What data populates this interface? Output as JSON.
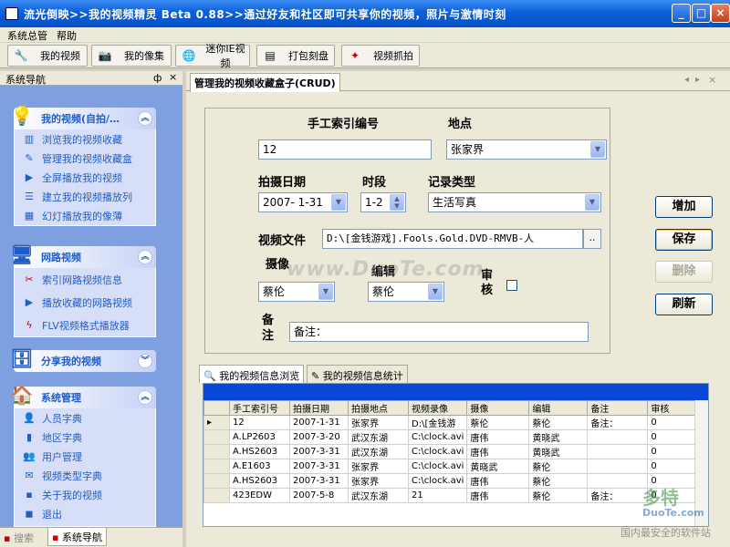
{
  "window": {
    "title": "流光倒映>>我的视频精灵 Beta 0.88>>通过好友和社区即可共享你的视频，照片与激情时刻"
  },
  "menu": [
    "系统总管",
    "帮助"
  ],
  "toolbar": [
    "我的视频",
    "我的像集",
    "迷你IE视频",
    "打包刻盘",
    "视频抓拍"
  ],
  "nav": {
    "title": "系统导航",
    "pin": "ф",
    "close": "×",
    "groups": [
      {
        "title": "我的视频(自拍/…",
        "items": [
          "浏览我的视频收藏",
          "管理我的视频收藏盒",
          "全屏播放我的视频",
          "建立我的视频播放列",
          "幻灯播放我的像薄"
        ]
      },
      {
        "title": "网路视频",
        "items": [
          "索引网路视频信息",
          "播放收藏的网路视频",
          "FLV视频格式播放器"
        ]
      },
      {
        "title": "分享我的视频",
        "items": []
      },
      {
        "title": "系统管理",
        "items": [
          "人员字典",
          "地区字典",
          "用户管理",
          "视频类型字典",
          "关于我的视频",
          "退出"
        ]
      }
    ],
    "bottom_tabs": [
      "搜索",
      "系统导航"
    ]
  },
  "main": {
    "tab": "管理我的视频收藏盒子(CRUD)",
    "form": {
      "index_label": "手工索引编号",
      "index_value": "12",
      "place_label": "地点",
      "place_value": "张家界",
      "date_label": "拍摄日期",
      "date_value": "2007- 1-31",
      "period_label": "时段",
      "period_value": "1-2",
      "type_label": "记录类型",
      "type_value": "生活写真",
      "file_label": "视频文件",
      "file_value": "D:\\[金钱游戏].Fools.Gold.DVD-RMVB-人",
      "file_btn": "..",
      "camera_label": "摄像",
      "camera_value": "蔡伦",
      "editor_label": "编辑",
      "editor_value": "蔡伦",
      "review_label": "审核",
      "remark_label": "备注",
      "remark_value": "备注："
    },
    "actions": [
      "增加",
      "保存",
      "删除",
      "刷新"
    ],
    "grid_tabs": [
      "我的视频信息浏览",
      "我的视频信息统计"
    ],
    "grid": {
      "columns": [
        "",
        "手工索引号",
        "拍摄日期",
        "拍摄地点",
        "视频录像",
        "摄像",
        "编辑",
        "备注",
        "审核"
      ],
      "rows": [
        [
          "▸",
          "12",
          "2007-1-31",
          "张家界",
          "D:\\[金钱游",
          "蔡伦",
          "蔡伦",
          "备注：",
          "0"
        ],
        [
          "",
          "A.LP2603",
          "2007-3-20",
          "武汉东湖",
          "C:\\clock.avi",
          "唐伟",
          "黄晓武",
          "",
          "0"
        ],
        [
          "",
          "A.HS2603",
          "2007-3-31",
          "武汉东湖",
          "C:\\clock.avi",
          "唐伟",
          "黄晓武",
          "",
          "0"
        ],
        [
          "",
          "A.E1603",
          "2007-3-31",
          "张家界",
          "C:\\clock.avi",
          "黄晓武",
          "蔡伦",
          "",
          "0"
        ],
        [
          "",
          "A.HS2603",
          "2007-3-31",
          "张家界",
          "C:\\clock.avi",
          "唐伟",
          "蔡伦",
          "",
          "0"
        ],
        [
          "",
          "423EDW",
          "2007-5-8",
          "武汉东湖",
          "21",
          "唐伟",
          "蔡伦",
          "备注：",
          "0"
        ]
      ]
    }
  },
  "watermark": "www.DuoTe.com",
  "corner_watermark": {
    "line1": "多特",
    "line2": "DuoTe.com",
    "line3": "国内最安全的软件站"
  }
}
